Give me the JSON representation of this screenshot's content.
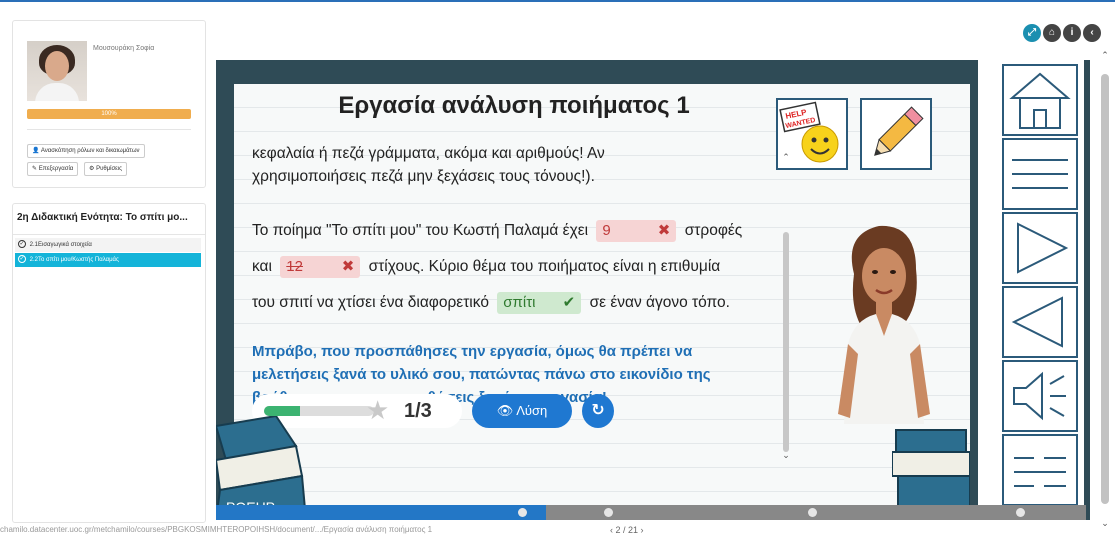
{
  "profile": {
    "name": "Μουσουράκη Σοφία",
    "progress_label": "100%",
    "progress_value": 1.0,
    "roles_button": "Ανασκόπηση ρόλων και δικαιωμάτων",
    "edit_button": "Επεξεργασία",
    "settings_button": "Ρυθμίσεις"
  },
  "course": {
    "title": "2η Διδακτική Ενότητα: Το σπίτι μο...",
    "items": [
      {
        "label": "2.1Εισαγωγικά στοιχεία",
        "active": false
      },
      {
        "label": "2.2Το σπίτι μου/Κωστής Παλαμάς",
        "active": true
      }
    ]
  },
  "top_icons": [
    "expand-icon",
    "home-icon",
    "info-icon",
    "back-icon"
  ],
  "lesson": {
    "title": "Εργασία ανάλυση ποιήματος 1",
    "para1": [
      "κεφαλαία ή πεζά γράμματα, ακόμα και αριθμούς! Αν",
      "χρησιμοποιήσεις πεζά μην ξεχάσεις τους τόνους!)."
    ],
    "para2": {
      "l1_before": "Το ποίημα \"Το σπίτι μου\" του Κωστή Παλαμά έχει",
      "blank1": "9",
      "l1_after": "στροφές",
      "l2_before": "και",
      "blank2": "12",
      "l2_after": "στίχους. Κύριο θέμα του ποιήματος είναι η επιθυμία",
      "l3_before": "του σπιτί να χτίσει ένα διαφορετικό",
      "blank3": "σπίτι",
      "l3_after": "σε έναν άγονο τόπο."
    },
    "feedback": [
      "Μπράβο, που προσπάθησες την εργασία, όμως θα πρέπει να",
      "μελετήσεις ξανά το υλικό σου, πατώντας πάνω στο εικονίδιο της",
      "βοήθειας και να προσπαθήσεις ξανά την εργασία!"
    ],
    "score_text": "1/3",
    "score_fraction": 0.33,
    "solution_button": "Λύση",
    "help_sign": "HELP WANTED",
    "book_label": "ΡΟΕΗΡ"
  },
  "footer": {
    "url": "chamilo.datacenter.uoc.gr/metchamilo/courses/PBGKOSMIMHTEROPOIHSH/document/.../Εργασία ανάλυση ποιήματος 1",
    "pager": "‹ 2 / 21 ›"
  }
}
